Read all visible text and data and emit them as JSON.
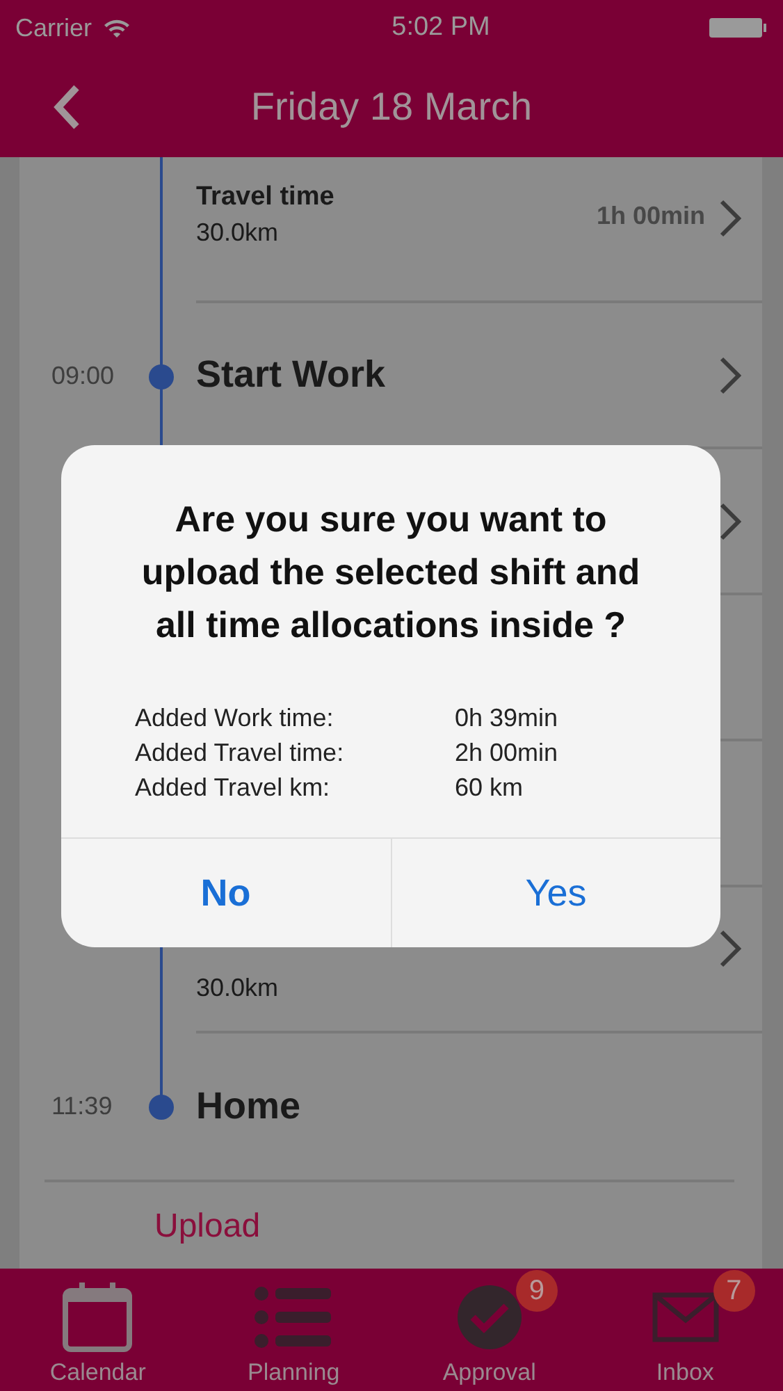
{
  "status_bar": {
    "carrier": "Carrier",
    "time": "5:02 PM"
  },
  "header": {
    "title": "Friday 18 March"
  },
  "timeline": [
    {
      "kind": "travel",
      "title": "Travel time",
      "distance": "30.0km",
      "duration": "1h 00min",
      "chevron": true
    },
    {
      "kind": "event",
      "time": "09:00",
      "title": "Start Work",
      "chevron": true
    },
    {
      "kind": "blank",
      "chevron": true
    },
    {
      "kind": "blank",
      "chevron": false
    },
    {
      "kind": "blank",
      "chevron": false
    },
    {
      "kind": "travel",
      "distance": "30.0km",
      "chevron": true
    },
    {
      "kind": "event",
      "time": "11:39",
      "title": "Home",
      "chevron": false
    }
  ],
  "upload": {
    "label": "Upload"
  },
  "dialog": {
    "title": "Are you sure you want to upload the selected shift and all time allocations inside ?",
    "details": [
      {
        "label": "Added Work time:",
        "value": "0h 39min"
      },
      {
        "label": "Added Travel time:",
        "value": "2h 00min"
      },
      {
        "label": "Added Travel km:",
        "value": "60 km"
      }
    ],
    "buttons": [
      {
        "label": "No",
        "kind": "cancel"
      },
      {
        "label": "Yes",
        "kind": "confirm"
      }
    ]
  },
  "tab_bar": [
    {
      "label": "Calendar"
    },
    {
      "label": "Planning"
    },
    {
      "label": "Approval",
      "badge": "9"
    },
    {
      "label": "Inbox",
      "badge": "7"
    }
  ]
}
